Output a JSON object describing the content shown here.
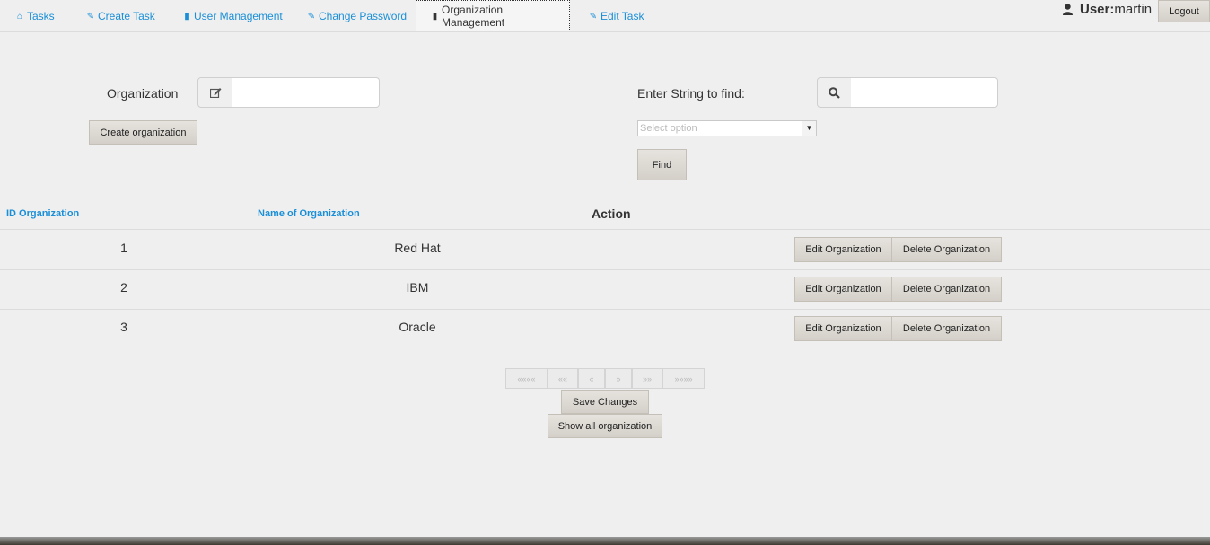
{
  "nav": {
    "tabs": [
      {
        "label": "Tasks",
        "icon": "home-icon"
      },
      {
        "label": "Create Task",
        "icon": "pencil-icon"
      },
      {
        "label": "User Management",
        "icon": "book-icon"
      },
      {
        "label": "Change Password",
        "icon": "pencil-icon"
      },
      {
        "label": "Organization Management",
        "icon": "book-icon",
        "active": true
      },
      {
        "label": "Edit Task",
        "icon": "pencil-icon"
      }
    ],
    "user_label": "User:",
    "user_name": "martin",
    "logout_label": "Logout"
  },
  "create_form": {
    "label": "Organization",
    "value": "",
    "button_label": "Create organization"
  },
  "search_form": {
    "label": "Enter String to find:",
    "value": "",
    "select_placeholder": "Select option",
    "find_label": "Find"
  },
  "table": {
    "headers": [
      "ID Organization",
      "Name of Organization",
      "Action"
    ],
    "rows": [
      {
        "id": "1",
        "name": "Red Hat"
      },
      {
        "id": "2",
        "name": "IBM"
      },
      {
        "id": "3",
        "name": "Oracle"
      }
    ],
    "edit_label": "Edit Organization",
    "delete_label": "Delete Organization"
  },
  "pagination": {
    "first": "««««",
    "prev_page": "««",
    "prev": "«",
    "next": "»",
    "next_page": "»»",
    "last": "»»»»"
  },
  "actions": {
    "save_label": "Save Changes",
    "show_all_label": "Show all organization"
  },
  "colors": {
    "accent": "#1a8fd8",
    "background": "#efefef"
  }
}
